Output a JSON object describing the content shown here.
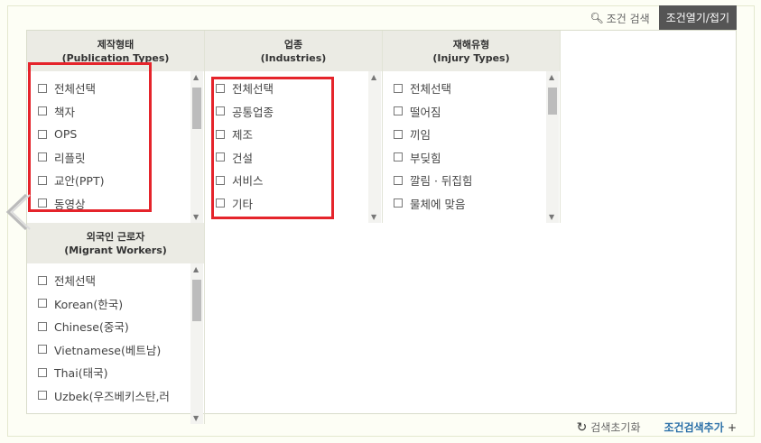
{
  "top_bar": {
    "search_label": "조건 검색",
    "toggle_label": "조건열기/접기"
  },
  "columns": [
    {
      "title_ko": "제작형태",
      "title_en": "(Publication Types)",
      "options": [
        "전체선택",
        "책자",
        "OPS",
        "리플릿",
        "교안(PPT)",
        "동영상"
      ]
    },
    {
      "title_ko": "업종",
      "title_en": "(Industries)",
      "options": [
        "전체선택",
        "공통업종",
        "제조",
        "건설",
        "서비스",
        "기타"
      ]
    },
    {
      "title_ko": "재해유형",
      "title_en": "(Injury Types)",
      "options": [
        "전체선택",
        "떨어짐",
        "끼임",
        "부딪힘",
        "깔림 · 뒤집힘",
        "물체에 맞음"
      ]
    },
    {
      "title_ko": "외국인 근로자",
      "title_en": "(Migrant Workers)",
      "options": [
        "전체선택",
        "Korean(한국)",
        "Chinese(중국)",
        "Vietnamese(베트남)",
        "Thai(태국)",
        "Uzbek(우즈베키스탄,러"
      ]
    }
  ],
  "bottom_bar": {
    "reset_label": "검색초기화",
    "add_label": "조건검색추가",
    "add_plus": "+"
  },
  "colors": {
    "highlight": "#e5242b",
    "accent": "#2a6fa8"
  }
}
